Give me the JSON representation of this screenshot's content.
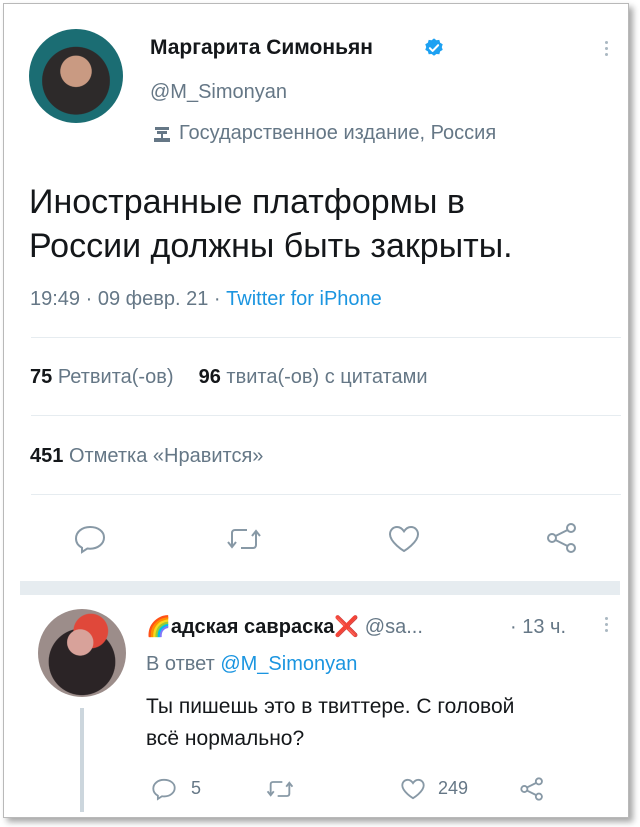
{
  "tweet": {
    "author_name": "Маргарита Симоньян",
    "handle": "@M_Simonyan",
    "label": "Государственное издание, Россия",
    "text_line1": "Иностранные платформы в",
    "text_line2": "России должны быть закрыты.",
    "time": "19:49",
    "date": "09 февр. 21",
    "sep": "·",
    "source": "Twitter for iPhone",
    "retweets_count": "75",
    "retweets_label": "Ретвита(-ов)",
    "quotes_count": "96",
    "quotes_label": "твита(-ов) с цитатами",
    "likes_count": "451",
    "likes_label": "Отметка «Нравится»"
  },
  "reply": {
    "emoji": "🌈",
    "author_name": "адская савраска",
    "cross": "❌",
    "handle": "@sa...",
    "time": "· 13 ч.",
    "in_reply_prefix": "В ответ",
    "in_reply_handle": "@M_Simonyan",
    "text_line1": "Ты пишешь это в твиттере.  С головой",
    "text_line2": "всё нормально?",
    "reply_count": "5",
    "like_count": "249"
  },
  "colors": {
    "link": "#1b95e0",
    "muted": "#657786",
    "verified": "#1da1f2",
    "separator_band": "#e6ecf0"
  }
}
